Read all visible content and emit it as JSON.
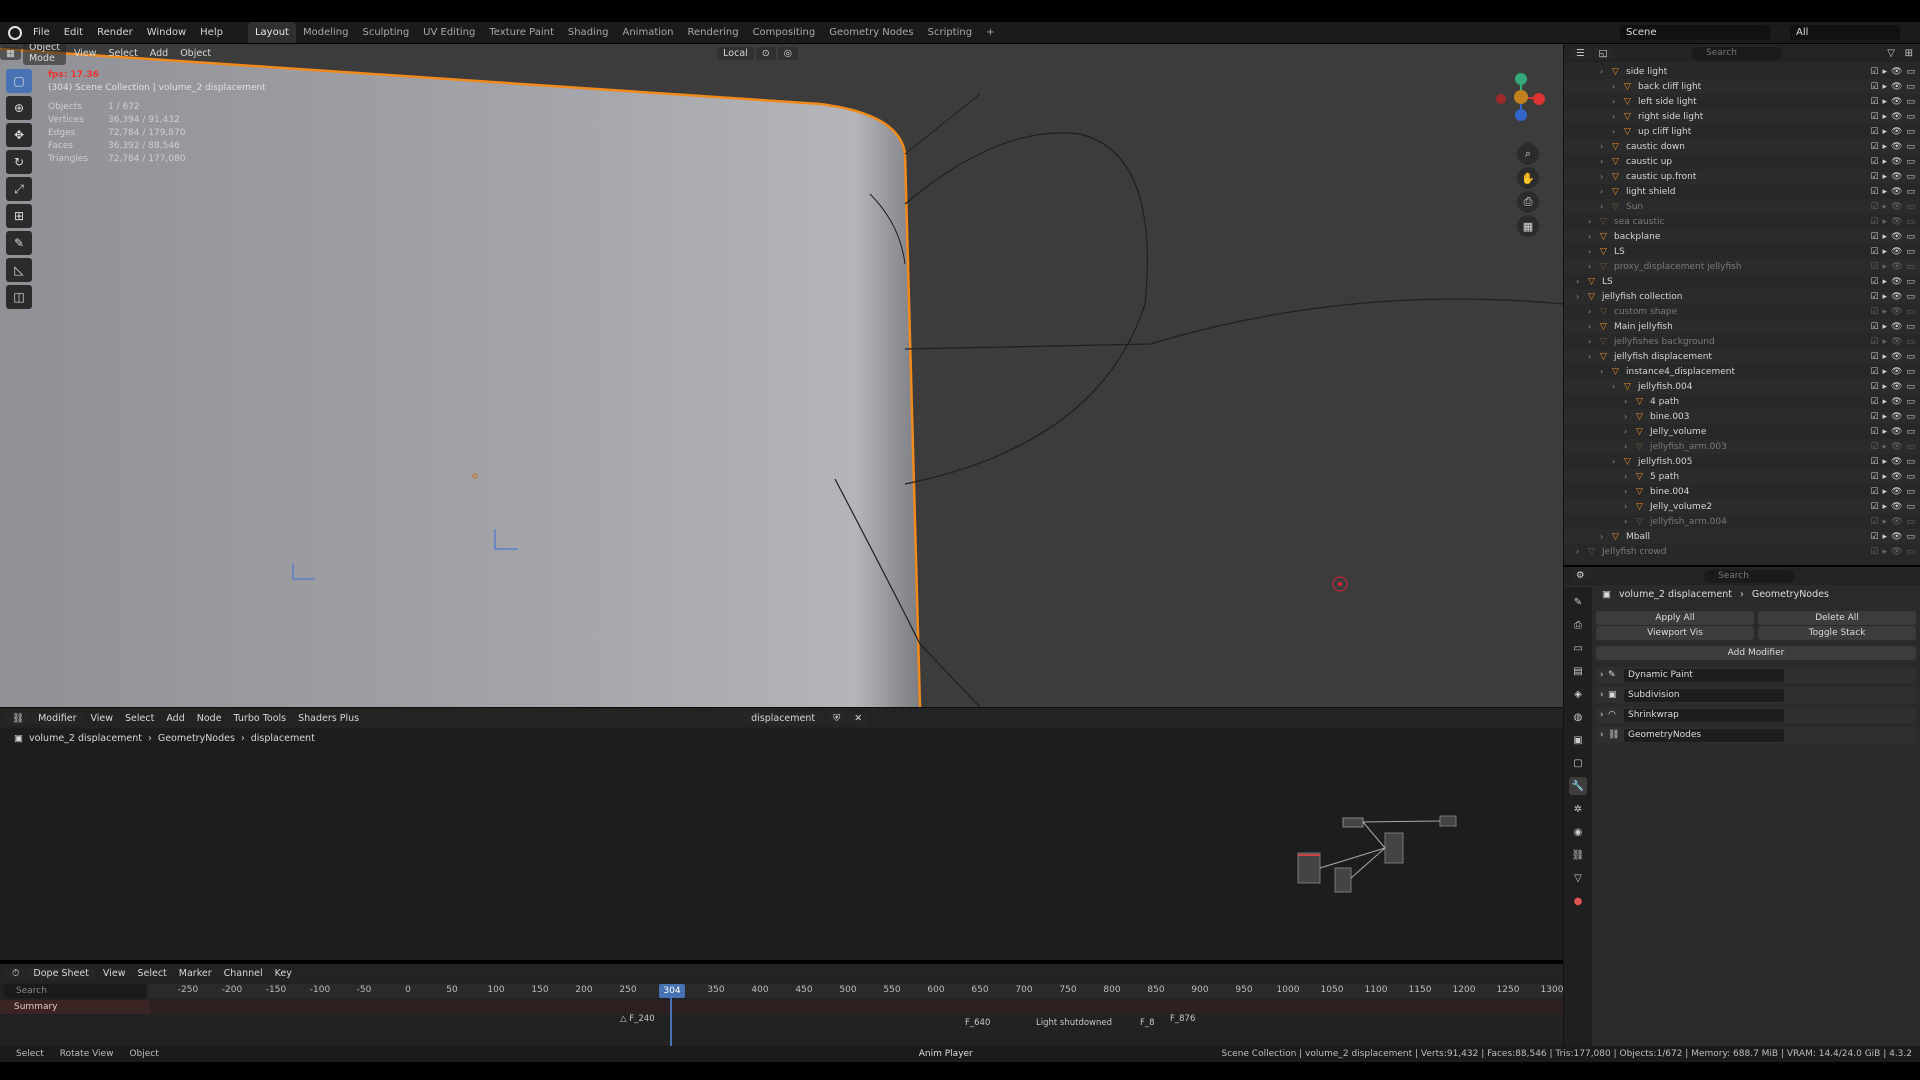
{
  "menus": [
    "File",
    "Edit",
    "Render",
    "Window",
    "Help"
  ],
  "workspaces": [
    "Layout",
    "Modeling",
    "Sculpting",
    "UV Editing",
    "Texture Paint",
    "Shading",
    "Animation",
    "Rendering",
    "Compositing",
    "Geometry Nodes",
    "Scripting",
    "+"
  ],
  "scene": "Scene",
  "view_layer": "All",
  "viewport": {
    "mode": "Object Mode",
    "menus": [
      "View",
      "Select",
      "Add",
      "Object"
    ],
    "transform_orientation": "Local",
    "fps": "fps: 17.36",
    "context": "(304) Scene Collection | volume_2 displacement",
    "stats": [
      {
        "label": "Objects",
        "value": "1 / 672"
      },
      {
        "label": "Vertices",
        "value": "36,394 / 91,432"
      },
      {
        "label": "Edges",
        "value": "72,784 / 179,870"
      },
      {
        "label": "Faces",
        "value": "36,392 / 88,546"
      },
      {
        "label": "Triangles",
        "value": "72,784 / 177,080"
      }
    ]
  },
  "node_editor": {
    "editor_type": "Modifier",
    "menus": [
      "View",
      "Select",
      "Add",
      "Node",
      "Turbo Tools",
      "Shaders Plus"
    ],
    "node_group": "displacement",
    "breadcrumb": [
      "volume_2 displacement",
      "GeometryNodes",
      "displacement"
    ]
  },
  "dopesheet": {
    "editor": "Dope Sheet",
    "menus": [
      "View",
      "Select",
      "Marker",
      "Channel",
      "Key"
    ],
    "search_placeholder": "Search",
    "summary": "Summary",
    "ticks": [
      "-250",
      "-200",
      "-150",
      "-100",
      "-50",
      "0",
      "50",
      "100",
      "150",
      "200",
      "250",
      "300",
      "350",
      "400",
      "450",
      "500",
      "550",
      "600",
      "650",
      "700",
      "750",
      "800",
      "850",
      "900",
      "950",
      "1000",
      "1050",
      "1100",
      "1150",
      "1200",
      "1250",
      "1300"
    ],
    "current_frame": "304",
    "markers": [
      "F_240",
      "F_640",
      "Light shutdowned",
      "F_8",
      "F_876"
    ]
  },
  "statusbar": {
    "left": [
      "Select",
      "Rotate View",
      "Object"
    ],
    "center": "Anim Player",
    "right": "Scene Collection | volume_2 displacement | Verts:91,432 | Faces:88,546 | Tris:177,080 | Objects:1/672 | Memory: 688.7 MiB | VRAM: 14.4/24.0 GiB | 4.3.2"
  },
  "outliner": {
    "search_placeholder": "Search",
    "rows": [
      {
        "label": "side light",
        "depth": 3,
        "dim": false
      },
      {
        "label": "back cliff light",
        "depth": 4,
        "dim": false
      },
      {
        "label": "left side light",
        "depth": 4,
        "dim": false
      },
      {
        "label": "right side light",
        "depth": 4,
        "dim": false
      },
      {
        "label": "up cliff light",
        "depth": 4,
        "dim": false
      },
      {
        "label": "caustic down",
        "depth": 3,
        "dim": false
      },
      {
        "label": "caustic up",
        "depth": 3,
        "dim": false
      },
      {
        "label": "caustic up.front",
        "depth": 3,
        "dim": false
      },
      {
        "label": "light shield",
        "depth": 3,
        "dim": false
      },
      {
        "label": "Sun",
        "depth": 3,
        "dim": true
      },
      {
        "label": "sea caustic",
        "depth": 2,
        "dim": true
      },
      {
        "label": "backplane",
        "depth": 2,
        "dim": false
      },
      {
        "label": "LS",
        "depth": 2,
        "dim": false
      },
      {
        "label": "proxy_displacement jellyfish",
        "depth": 2,
        "dim": true
      },
      {
        "label": "LS",
        "depth": 1,
        "dim": false
      },
      {
        "label": "jellyfish collection",
        "depth": 1,
        "dim": false
      },
      {
        "label": "custom shape",
        "depth": 2,
        "dim": true
      },
      {
        "label": "Main jellyfish",
        "depth": 2,
        "dim": false
      },
      {
        "label": "jellyfishes background",
        "depth": 2,
        "dim": true
      },
      {
        "label": "jellyfish displacement",
        "depth": 2,
        "dim": false
      },
      {
        "label": "instance4_displacement",
        "depth": 3,
        "dim": false
      },
      {
        "label": "jellyfish.004",
        "depth": 4,
        "dim": false
      },
      {
        "label": "4 path",
        "depth": 5,
        "dim": false
      },
      {
        "label": "bine.003",
        "depth": 5,
        "dim": false
      },
      {
        "label": "Jelly_volume",
        "depth": 5,
        "dim": false
      },
      {
        "label": "jellyfish_arm.003",
        "depth": 5,
        "dim": true
      },
      {
        "label": "jellyfish.005",
        "depth": 4,
        "dim": false
      },
      {
        "label": "5 path",
        "depth": 5,
        "dim": false
      },
      {
        "label": "bine.004",
        "depth": 5,
        "dim": false
      },
      {
        "label": "Jelly_volume2",
        "depth": 5,
        "dim": false
      },
      {
        "label": "jellyfish_arm.004",
        "depth": 5,
        "dim": true
      },
      {
        "label": "Mball",
        "depth": 3,
        "dim": false
      },
      {
        "label": "Jellyfish crowd",
        "depth": 1,
        "dim": true
      }
    ]
  },
  "properties": {
    "search_placeholder": "Search",
    "object": "volume_2 displacement",
    "modifier_tab": "GeometryNodes",
    "apply_all": "Apply All",
    "delete_all": "Delete All",
    "viewport_vis": "Viewport Vis",
    "toggle_stack": "Toggle Stack",
    "add_modifier": "Add Modifier",
    "modifiers": [
      "Dynamic Paint",
      "Subdivision",
      "Shrinkwrap",
      "GeometryNodes"
    ]
  },
  "colors": {
    "accent": "#4772b3",
    "selection": "#f08a1c",
    "fps": "#e33333"
  }
}
